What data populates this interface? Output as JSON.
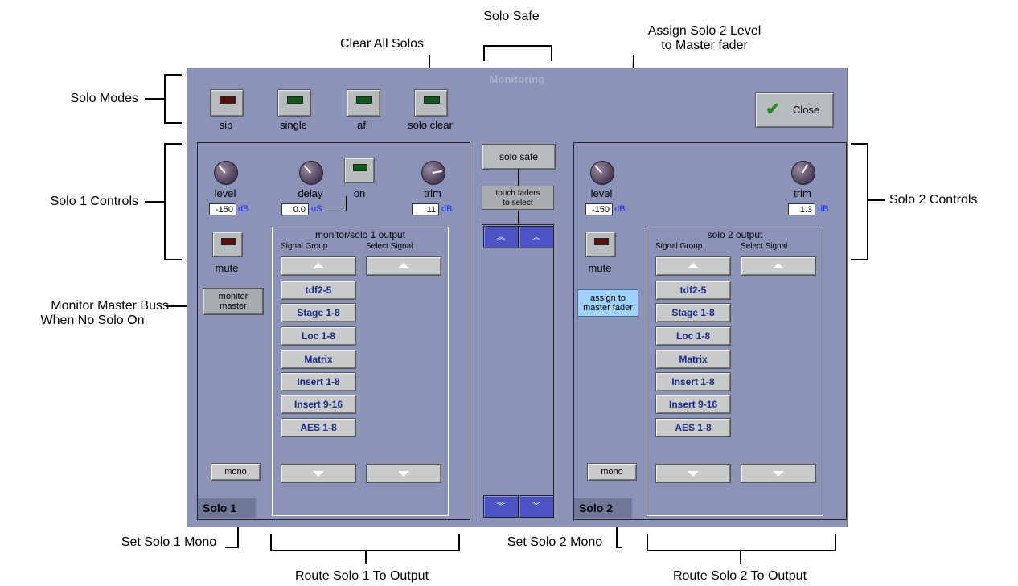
{
  "window": {
    "title": "Monitoring",
    "close_label": "Close"
  },
  "annotations": {
    "solo_safe": "Solo Safe",
    "clear_all_solos": "Clear All Solos",
    "assign_solo2_line1": "Assign Solo 2 Level",
    "assign_solo2_line2": "to Master fader",
    "solo_modes": "Solo Modes",
    "solo1_controls": "Solo 1 Controls",
    "solo2_controls": "Solo 2 Controls",
    "monitor_master_line1": "Monitor Master Buss",
    "monitor_master_line2": "When No Solo On",
    "set_solo1_mono": "Set Solo 1 Mono",
    "set_solo2_mono": "Set Solo 2 Mono",
    "route_solo1": "Route Solo 1 To Output",
    "route_solo2": "Route Solo 2 To Output"
  },
  "modes": [
    {
      "label": "sip",
      "led": "red"
    },
    {
      "label": "single",
      "led": "green"
    },
    {
      "label": "afl",
      "led": "green"
    },
    {
      "label": "solo clear",
      "led": "green"
    }
  ],
  "solo1": {
    "tab": "Solo 1",
    "level_label": "level",
    "level_value": "-150",
    "level_unit": "dB",
    "delay_label": "delay",
    "delay_value": "0.0",
    "delay_unit": "uS",
    "on_label": "on",
    "trim_label": "trim",
    "trim_value": "11",
    "trim_unit": "dB",
    "mute_label": "mute",
    "monitor_master_line1": "monitor",
    "monitor_master_line2": "master",
    "mono_label": "mono",
    "output_title": "monitor/solo 1 output",
    "col_signal_group": "Signal Group",
    "col_select_signal": "Select Signal",
    "groups": [
      "tdf2-5",
      "Stage 1-8",
      "Loc 1-8",
      "Matrix",
      "Insert 1-8",
      "Insert 9-16",
      "AES 1-8"
    ]
  },
  "solo2": {
    "tab": "Solo 2",
    "level_label": "level",
    "level_value": "-150",
    "level_unit": "dB",
    "trim_label": "trim",
    "trim_value": "1.3",
    "trim_unit": "dB",
    "mute_label": "mute",
    "assign_line1": "assign to",
    "assign_line2": "master fader",
    "mono_label": "mono",
    "output_title": "solo 2 output",
    "col_signal_group": "Signal Group",
    "col_select_signal": "Select Signal",
    "groups": [
      "tdf2-5",
      "Stage 1-8",
      "Loc 1-8",
      "Matrix",
      "Insert 1-8",
      "Insert 9-16",
      "AES 1-8"
    ]
  },
  "middle": {
    "solo_safe": "solo safe",
    "touch_line1": "touch faders",
    "touch_line2": "to select"
  },
  "icons": {
    "close": "check-icon",
    "scroll_top": "double-chevron-up-icon",
    "scroll_up": "chevron-up-icon",
    "scroll_bottom": "double-chevron-down-icon",
    "scroll_down": "chevron-down-icon"
  },
  "colors": {
    "panel": "#8b94b8",
    "led_red": "#5a1010",
    "led_green": "#0f5a18",
    "assign_button": "#9fd2ff",
    "scroll_button": "#4c54c4",
    "signal_text": "#1a2a8a"
  }
}
